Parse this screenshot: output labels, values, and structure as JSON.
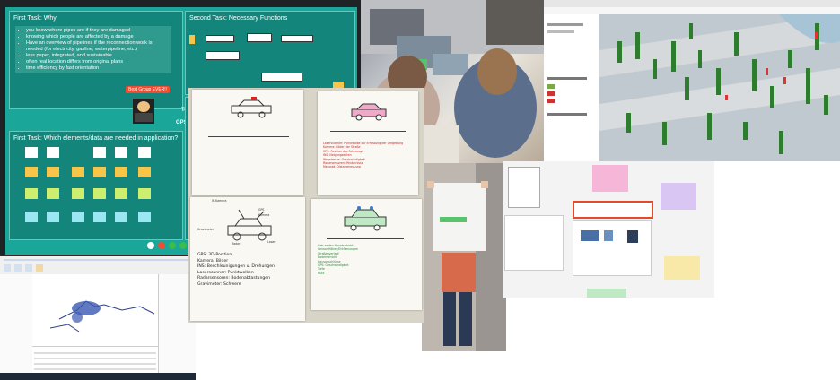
{
  "miro": {
    "task1_title": "First Task: Why",
    "task1_bullets": [
      "you know where pipes are if they are damaged",
      "knowing which people are affected by a damage",
      "Have an overview of pipelines if the reconnection work is needed (for electricity, gasline, waterpipeline, etc.)",
      "less paper, integrated, and sustainable",
      "often real location differs from original plans",
      "time efficiency by fast orientation"
    ],
    "task2_title": "Second Task: Necessary Functions",
    "task3_title": "First Task: Which elements/data are needed in application?",
    "best_group": "Best Group EVER!!",
    "side_label_1": "Top",
    "side_label_2": "GPS Tr",
    "colors": {
      "board": "#1aa79a",
      "panel": "#14857b",
      "sticky_white": "#ffffff",
      "sticky_orange": "#f6c54a",
      "sticky_green": "#cdee6e",
      "sticky_blue": "#9be6f3",
      "red": "#f24b30"
    }
  },
  "posters": {
    "poster1_lines": [
      "Laserscanner: Punktwolke zur Erfassung der Umgebung",
      "Kamera: Bilder der Straße",
      "GPS: Position des Fahrzeugs",
      "INS: Neigungsdaten",
      "Wegstrecke: Geschwindigkeit",
      "Radarsensoren: Hindernisse",
      "Messrad: Distanzmessung"
    ],
    "poster3_lines": [
      "GPS: 3D-Position",
      "Kamera: Bilder",
      "INS: Beschleunigungen u. Drehungen",
      "Laserscanner: Punktwolken",
      "Radarsensoren: Bodenabtastungen",
      "Gravimeter: Schwere"
    ],
    "poster3_car_labels": [
      "IR-Kamera",
      "GPS",
      "Kamera",
      "Gravimeter",
      "Radar",
      "Laser"
    ],
    "poster4_lines": [
      "Geb-enden Hauptschicht",
      "Sensor Höhen/Entfernungen",
      "Straßenverlauf",
      "Bodenschicht",
      "Hausanschlüsse",
      "GPS: Geschwindigkeit",
      "Tiefe",
      "Nutz"
    ]
  }
}
